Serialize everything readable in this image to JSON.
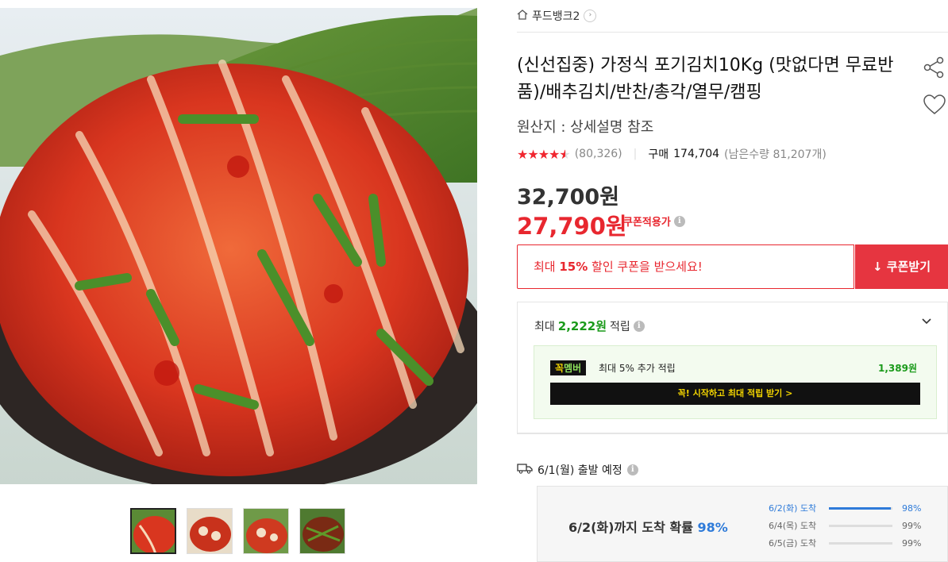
{
  "store": {
    "name": "푸드뱅크2"
  },
  "product": {
    "title": "(신선집중) 가정식 포기김치10Kg (맛없다면 무료반품)/배추김치/반찬/총각/열무/캠핑",
    "origin": "원산지 : 상세설명 참조",
    "rating": 4.5,
    "review_count": "(80,326)",
    "purchase_label": "구매",
    "purchase_count": "174,704",
    "stock": "(남은수량 81,207개)",
    "original_price": "32,700원",
    "sale_price": "27,790원",
    "coupon_tag": "쿠폰적용가",
    "icon_info": "info-icon"
  },
  "coupon": {
    "prefix": "최대 ",
    "highlight": "15%",
    "suffix": " 할인 쿠폰을 받으세요!",
    "button": "쿠폰받기"
  },
  "reward": {
    "prefix": "최대",
    "amount": "2,222원",
    "suffix": "적립",
    "member_badge_a": "꼭",
    "member_badge_b": "멤버",
    "member_text": "최대 5% 추가 적립",
    "member_amount": "1,389원",
    "member_button": "꼭! 시작하고 최대 적립 받기 >"
  },
  "shipping": {
    "label": "6/1(월) 출발 예정",
    "headline_prefix": "6/2(화)까지 도착 확률",
    "headline_pct": "98%",
    "rows": [
      {
        "date": "6/2(화) 도착",
        "pct": "98%",
        "value": 98,
        "color": "#2f7bd9"
      },
      {
        "date": "6/4(목) 도착",
        "pct": "99%",
        "value": 99,
        "color": "#dddddd"
      },
      {
        "date": "6/5(금) 도착",
        "pct": "99%",
        "value": 99,
        "color": "#dddddd"
      }
    ]
  },
  "colors": {
    "accent_red": "#e8272f",
    "reward_green": "#1a9a1a",
    "ship_blue": "#2f7bd9"
  }
}
